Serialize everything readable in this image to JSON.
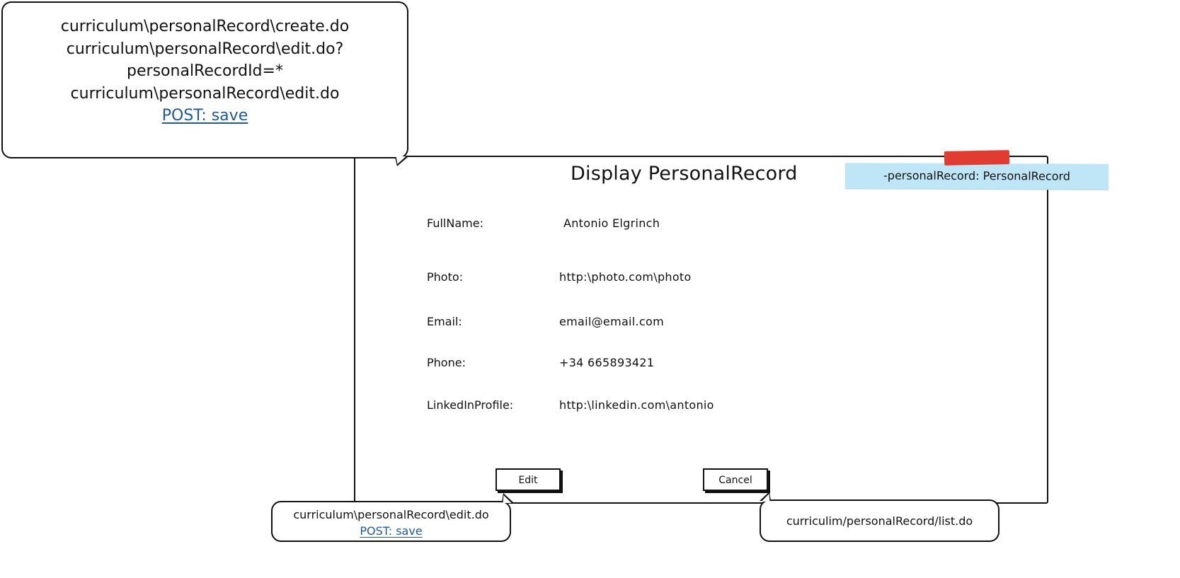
{
  "page": {
    "title": "Display PersonalRecord"
  },
  "sticky_note": {
    "text": "-personalRecord: PersonalRecord",
    "color": "#bfe6f6",
    "tape_color": "#e03c32"
  },
  "fields": [
    {
      "label": "FullName:",
      "value": "Antonio Elgrinch"
    },
    {
      "label": "Photo:",
      "value": "http:\\photo.com\\photo"
    },
    {
      "label": "Email:",
      "value": "email@email.com"
    },
    {
      "label": "Phone:",
      "value": "+34 665893421"
    },
    {
      "label": "LinkedInProfile:",
      "value": "http:\\linkedin.com\\antonio"
    }
  ],
  "buttons": {
    "edit": "Edit",
    "cancel": "Cancel"
  },
  "annotations": {
    "main": {
      "lines": [
        "curriculum\\personalRecord\\create.do",
        "curriculum\\personalRecord\\edit.do?",
        "personalRecordId=*",
        "curriculum\\personalRecord\\edit.do"
      ],
      "link": "POST: save"
    },
    "edit": {
      "line": "curriculum\\personalRecord\\edit.do",
      "link": "POST: save"
    },
    "cancel": {
      "line": "curriculim/personalRecord/list.do"
    }
  },
  "colors": {
    "link": "#1e5aa0",
    "border": "#111111"
  }
}
